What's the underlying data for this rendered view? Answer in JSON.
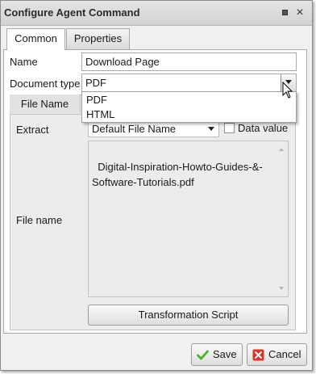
{
  "window": {
    "title": "Configure Agent Command",
    "pin_icon": "pin-icon",
    "close_icon": "close-icon",
    "close_glyph": "×"
  },
  "tabs": [
    {
      "label": "Common",
      "selected": true
    },
    {
      "label": "Properties",
      "selected": false
    }
  ],
  "form": {
    "name_label": "Name",
    "name_value": "Download Page",
    "doctype_label": "Document type",
    "doctype_value": "PDF",
    "doctype_options": [
      "PDF",
      "HTML"
    ]
  },
  "file_name_panel": {
    "tab_label": "File Name",
    "extract_label": "Extract",
    "extract_value": "Default File Name",
    "data_value_label": "Data value",
    "data_value_checked": false,
    "file_name_label": "File name",
    "file_name_value": "Digital-Inspiration-Howto-Guides-&-Software-Tutorials.pdf",
    "transform_button": "Transformation Script"
  },
  "footer": {
    "save_label": "Save",
    "cancel_label": "Cancel"
  },
  "colors": {
    "save_icon": "#4caf2e",
    "cancel_icon": "#d9342b"
  }
}
